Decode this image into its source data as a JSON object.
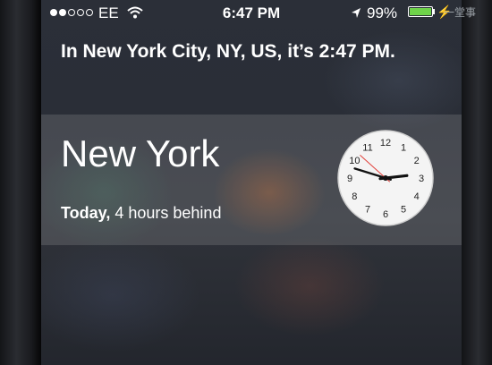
{
  "status_bar": {
    "carrier": "EE",
    "time": "6:47 PM",
    "battery_percent": "99%",
    "battery_level": 0.99,
    "signal_bars_filled": 2,
    "signal_bars_total": 5
  },
  "siri": {
    "response": "In New York City, NY, US, it’s 2:47 PM."
  },
  "world_clock": {
    "city": "New York",
    "day": "Today,",
    "offset": "4 hours behind",
    "clock_hour": 2,
    "clock_minute": 47,
    "clock_second": 52,
    "numerals": [
      "12",
      "1",
      "2",
      "3",
      "4",
      "5",
      "6",
      "7",
      "8",
      "9",
      "10",
      "11"
    ]
  },
  "watermark": "一堂事",
  "colors": {
    "battery_fill": "#6fd34a",
    "second_hand": "#e2403a"
  }
}
